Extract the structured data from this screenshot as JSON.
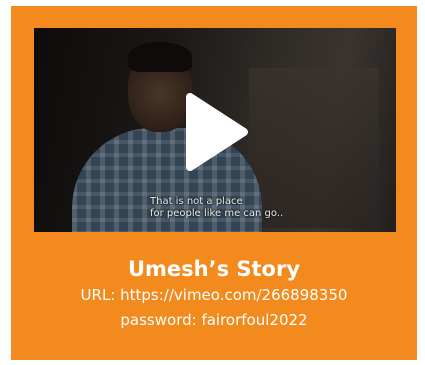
{
  "card": {
    "title": "Umesh’s Story",
    "url_line": "URL: https://vimeo.com/266898350",
    "password_line": "password: fairorfoul2022"
  },
  "video": {
    "subtitle": "That is not a place\nfor people like me can go..",
    "play_icon": "play-icon"
  },
  "colors": {
    "card_background": "#f28a1e",
    "text": "#ffffff"
  }
}
